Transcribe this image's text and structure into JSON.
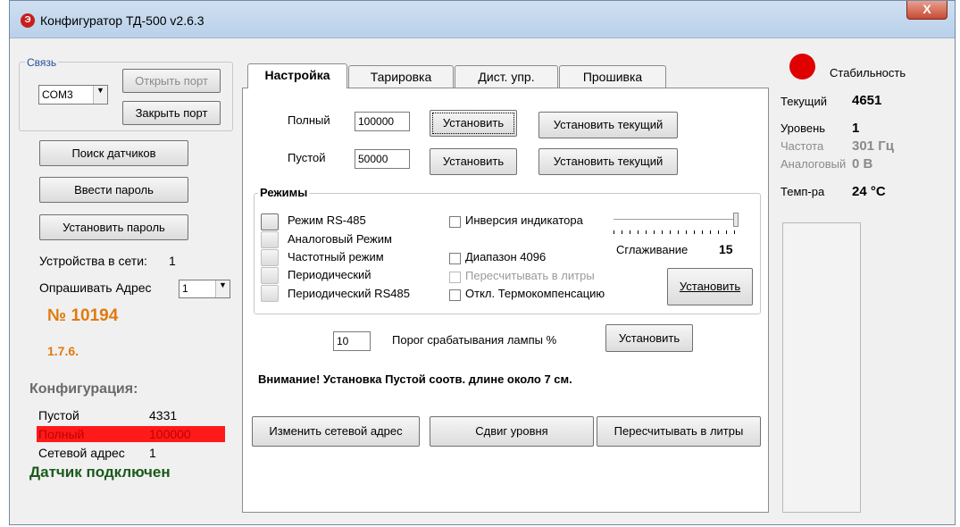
{
  "window": {
    "title": "Конфигуратор ТД-500 v2.6.3",
    "close": "X",
    "app_icon_glyph": "Э"
  },
  "connection": {
    "group_title": "Связь",
    "port_value": "COM3",
    "open_port": "Открыть порт",
    "close_port": "Закрыть порт"
  },
  "left": {
    "search_sensors": "Поиск датчиков",
    "enter_password": "Ввести пароль",
    "set_password": "Установить пароль",
    "devices_label": "Устройства в сети:",
    "devices_count": "1",
    "poll_address_label": "Опрашивать Адрес",
    "poll_address_value": "1",
    "serial": "№ 10194",
    "version": "1.7.6.",
    "config_title": "Конфигурация:",
    "config": [
      {
        "label": "Пустой",
        "value": "4331"
      },
      {
        "label": "Полный",
        "value": "100000"
      },
      {
        "label": "Сетевой адрес",
        "value": "1"
      }
    ],
    "status": "Датчик подключен"
  },
  "tabs": [
    {
      "label": "Настройка"
    },
    {
      "label": "Тарировка"
    },
    {
      "label": "Дист. упр."
    },
    {
      "label": "Прошивка"
    }
  ],
  "settings": {
    "full_label": "Полный",
    "full_value": "100000",
    "empty_label": "Пустой",
    "empty_value": "50000",
    "set": "Установить",
    "set_current": "Установить текущий",
    "modes_title": "Режимы",
    "modes": [
      "Режим RS-485",
      "Аналоговый Режим",
      "Частотный режим",
      "Периодический",
      "Периодический RS485"
    ],
    "checkboxes": [
      {
        "label": "Инверсия индикатора",
        "disabled": false
      },
      {
        "label": "Диапазон 4096",
        "disabled": false
      },
      {
        "label": "Пересчитывать в литры",
        "disabled": true
      },
      {
        "label": "Откл. Термокомпенсацию",
        "disabled": false
      }
    ],
    "smoothing_label": "Сглаживание",
    "smoothing_value": "15",
    "smoothing_level": 1.0,
    "modes_set": "Установить",
    "threshold_value": "10",
    "threshold_label": "Порог срабатывания лампы %",
    "threshold_set": "Установить",
    "warning": "Внимание! Установка Пустой соотв. длине около 7 см.",
    "change_address": "Изменить сетевой адрес",
    "level_shift": "Сдвиг уровня",
    "recalc_liters": "Пересчитывать в литры"
  },
  "readings": {
    "stability": "Стабильность",
    "rows": [
      {
        "label": "Текущий",
        "value": "4651",
        "dim": false
      },
      {
        "label": "Уровень",
        "value": "1",
        "dim": false
      },
      {
        "label": "Частота",
        "value": "301 Гц",
        "dim": true
      },
      {
        "label": "Аналоговый",
        "value": "0 В",
        "dim": true
      },
      {
        "label": "Темп-ра",
        "value": "24 °С",
        "dim": false
      }
    ]
  },
  "colors": {
    "indicator": "#e00000",
    "highlight_row": "#ff1a1a",
    "serial": "#e07a10",
    "status": "#1a5a1a"
  }
}
